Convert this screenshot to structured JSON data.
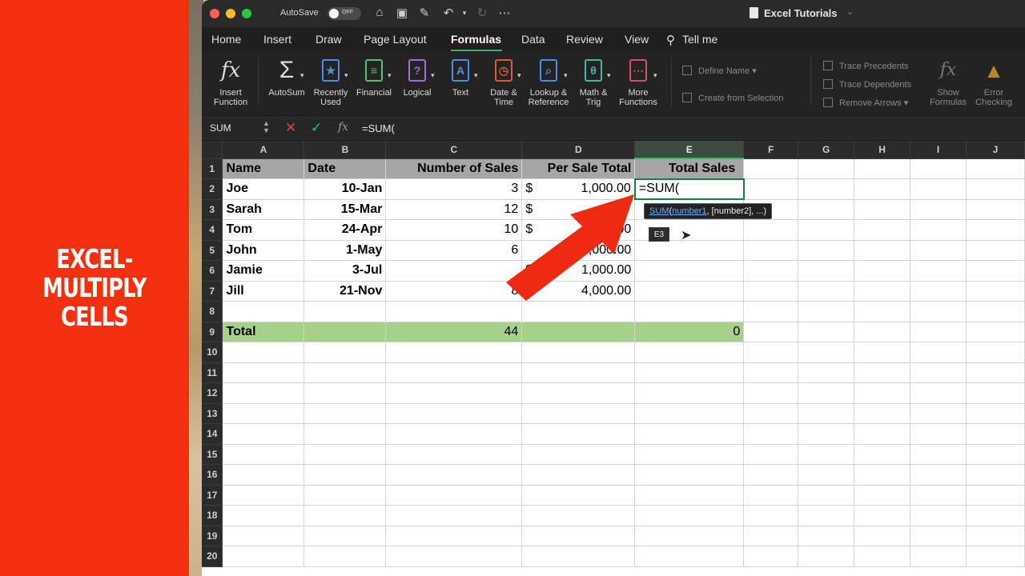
{
  "banner": {
    "lines": [
      "EXCEL-",
      "MULTIPLY",
      "CELLS"
    ]
  },
  "titlebar": {
    "autosave_label": "AutoSave",
    "autosave_state": "OFF",
    "document_title": "Excel Tutorials"
  },
  "tabs": [
    "Home",
    "Insert",
    "Draw",
    "Page Layout",
    "Formulas",
    "Data",
    "Review",
    "View",
    "Tell me"
  ],
  "active_tab": "Formulas",
  "ribbon": {
    "buttons": [
      {
        "label1": "Insert",
        "label2": "Function",
        "icon": "fx-icon"
      },
      {
        "label1": "AutoSum",
        "label2": "",
        "icon": "sigma-icon"
      },
      {
        "label1": "Recently",
        "label2": "Used",
        "icon": "star-icon"
      },
      {
        "label1": "Financial",
        "label2": "",
        "icon": "database-icon"
      },
      {
        "label1": "Logical",
        "label2": "",
        "icon": "question-icon"
      },
      {
        "label1": "Text",
        "label2": "",
        "icon": "text-icon"
      },
      {
        "label1": "Date &",
        "label2": "Time",
        "icon": "clock-icon"
      },
      {
        "label1": "Lookup &",
        "label2": "Reference",
        "icon": "magnifier-icon"
      },
      {
        "label1": "Math &",
        "label2": "Trig",
        "icon": "theta-icon"
      },
      {
        "label1": "More",
        "label2": "Functions",
        "icon": "more-functions-icon"
      },
      {
        "label1": "Show",
        "label2": "Formulas",
        "icon": "show-formulas-icon"
      },
      {
        "label1": "Error",
        "label2": "Checking",
        "icon": "warning-icon"
      }
    ],
    "define_name": "Define Name",
    "create_from_selection": "Create from Selection",
    "trace_precedents": "Trace Precedents",
    "trace_dependents": "Trace Dependents",
    "remove_arrows": "Remove Arrows"
  },
  "formula_bar": {
    "name_box": "SUM",
    "content": "=SUM("
  },
  "columns": [
    "A",
    "B",
    "C",
    "D",
    "E",
    "F",
    "G",
    "H",
    "I",
    "J"
  ],
  "selected_column": "E",
  "sheet": {
    "header": [
      "Name",
      "Date",
      "Number of Sales",
      "Per Sale Total",
      "Total Sales"
    ],
    "rows": [
      {
        "name": "Joe",
        "date": "10-Jan",
        "sales": "3",
        "cur": "$",
        "per": "1,000.00",
        "total": "=SUM("
      },
      {
        "name": "Sarah",
        "date": "15-Mar",
        "sales": "12",
        "cur": "$",
        "per": "",
        "total": ""
      },
      {
        "name": "Tom",
        "date": "24-Apr",
        "sales": "10",
        "cur": "$",
        "per": "00",
        "total": ""
      },
      {
        "name": "John",
        "date": "1-May",
        "sales": "6",
        "cur": "",
        "per": "3,000.00",
        "total": ""
      },
      {
        "name": "Jamie",
        "date": "3-Jul",
        "sales": "",
        "cur": "$",
        "per": "1,000.00",
        "total": ""
      },
      {
        "name": "Jill",
        "date": "21-Nov",
        "sales": "8",
        "cur": "$",
        "per": "4,000.00",
        "total": ""
      }
    ],
    "total_row": {
      "label": "Total",
      "sales": "44",
      "total": "0"
    },
    "row_numbers": [
      "1",
      "2",
      "3",
      "4",
      "5",
      "6",
      "7",
      "8",
      "9",
      "10",
      "11",
      "12",
      "13",
      "14",
      "15",
      "16",
      "17",
      "18",
      "19",
      "20"
    ]
  },
  "autocomplete": {
    "fn": "SUM",
    "open": "(",
    "arg1": "number1",
    "rest": ", [number2], ...)"
  },
  "cell_reference_tooltip": "E3",
  "colors": {
    "banner": "#f2300f",
    "header_fill": "#a6a6a6",
    "total_fill": "#a8d08d",
    "arrow": "#ee2a12",
    "accent": "#37b36a"
  }
}
